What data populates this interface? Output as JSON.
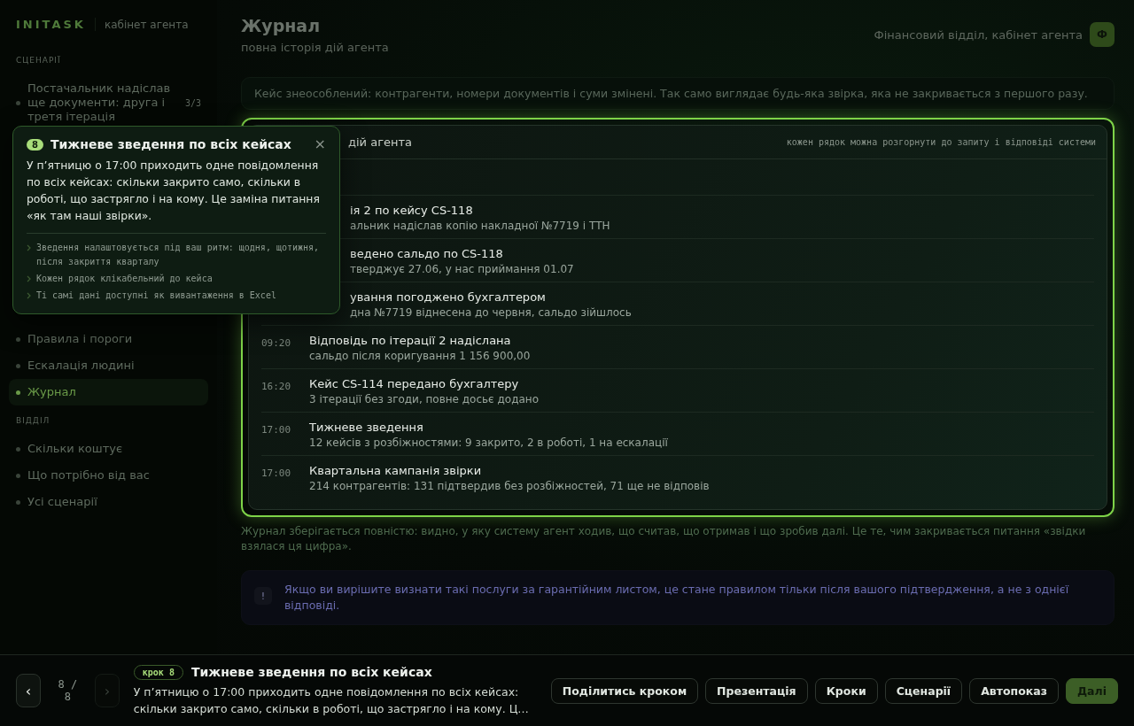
{
  "sidebar": {
    "brand": "INITASK",
    "subtitle": "кабінет агента",
    "sections": [
      {
        "label": "СЦЕНАРІЇ",
        "items": [
          {
            "label": "Постачальник надіслав ще документи: друга і третя ітерація",
            "count": "3/3",
            "selected": false
          }
        ]
      },
      {
        "items": [
          {
            "label": "Правила і пороги",
            "selected": false
          },
          {
            "label": "Ескалація людині",
            "selected": false
          },
          {
            "label": "Журнал",
            "selected": true
          }
        ]
      },
      {
        "label": "ВІДДІЛ",
        "items": [
          {
            "label": "Скільки коштує",
            "selected": false
          },
          {
            "label": "Що потрібно від вас",
            "selected": false
          },
          {
            "label": "Усі сценарії",
            "selected": false
          }
        ]
      }
    ]
  },
  "header": {
    "title": "Журнал",
    "subtitle": "повна історія дій агента",
    "account": "Фінансовий відділ, кабінет агента",
    "avatar": "Ф"
  },
  "notice": "Кейс знеособлений: контрагенти, номери документів і суми змінені. Так само виглядає будь-яка звірка, яка не закривається з першого разу.",
  "log": {
    "title": "дій агента",
    "hint": "кожен рядок можна розгорнути до запиту і відповіді системи",
    "rows": [
      {
        "kind": "partial",
        "title": "ія 2 по кейсу CS-118",
        "detail": "альник надіслав копію накладної №7719 і ТТН"
      },
      {
        "kind": "partial",
        "title": "ведено сальдо по CS-118",
        "detail": "тверджує 27.06, у нас приймання 01.07"
      },
      {
        "kind": "partial",
        "title": "ування погоджено бухгалтером",
        "detail": "дна №7719 віднесена до червня, сальдо зійшлось"
      },
      {
        "kind": "full",
        "time": "09:20",
        "title": "Відповідь по ітерації 2 надіслана",
        "detail": "сальдо після коригування 1 156 900,00"
      },
      {
        "kind": "full",
        "time": "16:20",
        "title": "Кейс CS-114 передано бухгалтеру",
        "detail": "3 ітерації без згоди, повне досьє додано"
      },
      {
        "kind": "full",
        "time": "17:00",
        "title": "Тижневе зведення",
        "detail": "12 кейсів з розбіжностями: 9 закрито, 2 в роботі, 1 на ескалації"
      },
      {
        "kind": "full",
        "time": "17:00",
        "title": "Квартальна кампанія звірки",
        "detail": "214 контрагентів: 131 підтвердив без розбіжностей, 71 ще не відповів"
      }
    ]
  },
  "footnote": "Журнал зберігається повністю: видно, у яку систему агент ходив, що считав, що отримав і що зробив далі. Це те, чим закривається питання «звідки взялася ця цифра».",
  "warning": {
    "mark": "!",
    "text": "Якщо ви вирішите визнати такі послуги за гарантійним листом, це стане правилом тільки після вашого підтвердження, а не з однієї відповіді."
  },
  "popover": {
    "step": "8",
    "title": "Тижневе зведення по всіх кейсах",
    "close": "×",
    "body": "У п’ятницю о 17:00 приходить одне повідомлення по всіх кейсах: скільки закрито само, скільки в роботі, що застрягло і на кому. Це заміна питання «як там наші звірки».",
    "points": [
      "Зведення налаштовується під ваш ритм: щодня, щотижня, після закриття кварталу",
      "Кожен рядок клікабельний до кейса",
      "Ті самі дані доступні як вивантаження в Excel"
    ]
  },
  "tour": {
    "prev": "‹",
    "next": "›",
    "next_disabled": true,
    "counter": "8 / 8",
    "step_badge": "крок 8",
    "title": "Тижневе зведення по всіх кейсах",
    "text": "У п’ятницю о 17:00 приходить одне повідомлення по всіх кейсах: скільки закрито само, скільки в роботі, що застрягло і на кому. Ц…",
    "actions": [
      {
        "label": "Поділитись кроком",
        "kind": "outline"
      },
      {
        "label": "Презентація",
        "kind": "outline"
      },
      {
        "label": "Кроки",
        "kind": "outline"
      },
      {
        "label": "Сценарії",
        "kind": "outline"
      },
      {
        "label": "Автопоказ",
        "kind": "outline"
      },
      {
        "label": "Далі",
        "kind": "primary"
      }
    ]
  }
}
